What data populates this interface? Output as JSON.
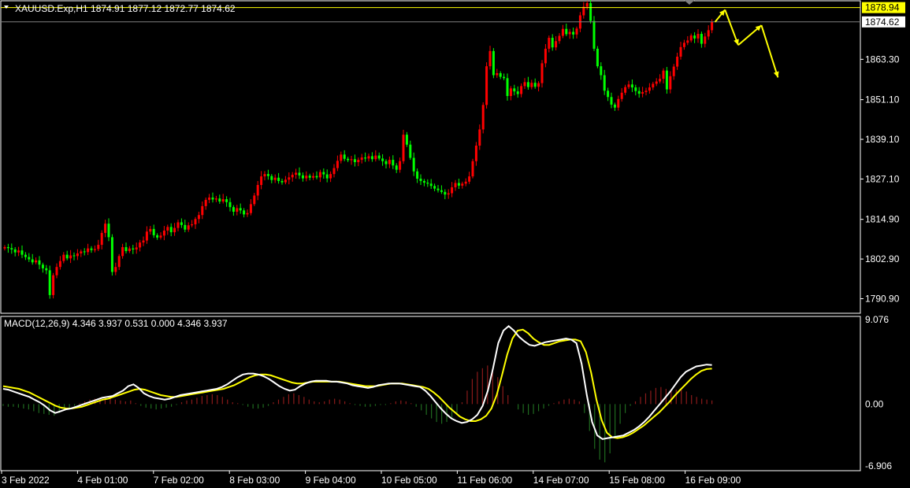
{
  "window": {
    "symbol_info": "XAUUSD.Exp,H1  1874.91 1877.12 1872.77 1874.62",
    "macd_info": "MACD(12,26,9) 4.346 3.937 0.531 0.000 4.346 3.937"
  },
  "colors": {
    "background": "#000000",
    "frame": "#ffffff",
    "bull": "#ff0000",
    "bear": "#00ff00",
    "hist_pos": "#8b1a1a",
    "hist_neg": "#1f6b1f",
    "macd_line": "#ffffff",
    "signal_line": "#ffff00",
    "forecast_arrow": "#ffff00",
    "level_line": "#ffff00",
    "bid_line": "#808080"
  },
  "price_axis": {
    "ticks": [
      "1863.30",
      "1851.10",
      "1839.10",
      "1827.10",
      "1814.90",
      "1802.90",
      "1790.90"
    ],
    "level_high": "1878.94",
    "level_current": "1874.62"
  },
  "macd_axis": {
    "ticks": [
      "9.076",
      "0.00",
      "-6.906"
    ]
  },
  "time_axis": {
    "labels": [
      "3 Feb 2022",
      "4 Feb 01:00",
      "7 Feb 02:00",
      "8 Feb 03:00",
      "9 Feb 04:00",
      "10 Feb 05:00",
      "11 Feb 06:00",
      "14 Feb 07:00",
      "15 Feb 08:00",
      "16 Feb 09:00"
    ]
  },
  "chart_data": {
    "type": "line",
    "title": "XAUUSD.Exp,H1",
    "price_range": [
      1786.5,
      1881.0
    ],
    "macd_range": [
      -6.906,
      9.076
    ],
    "close_series": [
      1806.5,
      1806.2,
      1805.8,
      1804.9,
      1805.5,
      1804.2,
      1803.5,
      1802.8,
      1801.9,
      1802.5,
      1801.2,
      1800.1,
      1799.5,
      1792.0,
      1798.0,
      1800.5,
      1802.3,
      1804.2,
      1803.1,
      1804.0,
      1803.8,
      1804.6,
      1805.2,
      1805.0,
      1806.1,
      1805.6,
      1805.9,
      1807.2,
      1810.8,
      1813.6,
      1809.5,
      1799.0,
      1800.5,
      1803.8,
      1806.5,
      1805.3,
      1806.1,
      1805.8,
      1806.4,
      1807.9,
      1808.5,
      1811.2,
      1812.0,
      1810.1,
      1809.4,
      1810.0,
      1811.5,
      1812.6,
      1811.0,
      1812.3,
      1814.0,
      1813.2,
      1811.8,
      1813.1,
      1813.4,
      1815.0,
      1816.2,
      1818.9,
      1820.8,
      1821.5,
      1820.9,
      1821.2,
      1820.3,
      1821.0,
      1820.1,
      1818.6,
      1817.2,
      1818.3,
      1817.6,
      1816.4,
      1816.8,
      1819.5,
      1822.1,
      1825.3,
      1827.9,
      1828.6,
      1828.0,
      1826.8,
      1827.5,
      1826.5,
      1826.1,
      1826.9,
      1827.6,
      1828.4,
      1829.0,
      1828.2,
      1827.3,
      1828.1,
      1827.5,
      1828.0,
      1827.6,
      1829.2,
      1828.5,
      1827.3,
      1828.6,
      1830.4,
      1832.6,
      1834.5,
      1833.2,
      1832.8,
      1833.1,
      1832.2,
      1832.9,
      1833.6,
      1833.3,
      1834.0,
      1833.1,
      1834.2,
      1833.3,
      1832.5,
      1831.6,
      1832.9,
      1831.2,
      1829.9,
      1832.5,
      1840.5,
      1837.5,
      1833.5,
      1829.4,
      1827.2,
      1826.5,
      1826.0,
      1825.7,
      1825.0,
      1824.2,
      1823.7,
      1823.2,
      1822.4,
      1822.8,
      1824.6,
      1825.9,
      1825.1,
      1825.7,
      1826.3,
      1827.9,
      1832.5,
      1837.2,
      1842.1,
      1849.5,
      1861.2,
      1865.8,
      1858.5,
      1859.1,
      1858.0,
      1857.6,
      1852.2,
      1854.5,
      1853.6,
      1852.8,
      1855.2,
      1856.4,
      1854.9,
      1856.2,
      1855.0,
      1856.1,
      1862.1,
      1866.5,
      1869.8,
      1866.9,
      1868.8,
      1870.4,
      1872.5,
      1870.9,
      1871.6,
      1870.8,
      1872.6,
      1876.6,
      1879.2,
      1880.3,
      1874.9,
      1866.5,
      1861.2,
      1858.5,
      1853.8,
      1851.9,
      1849.6,
      1848.7,
      1851.3,
      1853.2,
      1854.9,
      1855.7,
      1854.8,
      1853.7,
      1852.9,
      1853.4,
      1853.8,
      1854.8,
      1855.9,
      1856.6,
      1857.4,
      1859.9,
      1854.2,
      1858.2,
      1861.1,
      1864.1,
      1867.0,
      1868.3,
      1869.0,
      1870.5,
      1869.6,
      1871.0,
      1868.0,
      1870.2,
      1872.1,
      1874.6
    ],
    "forecast_path": [
      [
        1874.6,
        0
      ],
      [
        1878.3,
        3
      ],
      [
        1867.6,
        7
      ],
      [
        1873.6,
        14
      ],
      [
        1857.8,
        19
      ]
    ],
    "macd_line": [
      1.7,
      1.6,
      1.4,
      1.2,
      1.0,
      0.8,
      0.5,
      0.2,
      -0.2,
      -0.7,
      -1.0,
      -0.8,
      -0.6,
      -0.5,
      -0.3,
      -0.1,
      0.1,
      0.3,
      0.5,
      0.7,
      0.8,
      0.9,
      1.2,
      1.5,
      2.0,
      2.2,
      1.8,
      1.2,
      0.9,
      0.7,
      0.6,
      0.5,
      0.6,
      0.8,
      1.0,
      1.1,
      1.2,
      1.3,
      1.4,
      1.5,
      1.6,
      1.7,
      1.9,
      2.2,
      2.6,
      3.0,
      3.3,
      3.4,
      3.4,
      3.3,
      3.1,
      2.8,
      2.4,
      2.0,
      1.7,
      1.5,
      1.6,
      2.0,
      2.3,
      2.5,
      2.6,
      2.6,
      2.6,
      2.5,
      2.5,
      2.4,
      2.3,
      2.1,
      2.0,
      1.9,
      1.8,
      1.9,
      2.1,
      2.2,
      2.3,
      2.3,
      2.3,
      2.2,
      2.1,
      2.0,
      1.9,
      1.5,
      0.9,
      0.2,
      -0.5,
      -1.1,
      -1.6,
      -1.9,
      -2.1,
      -2.0,
      -1.7,
      -1.2,
      -0.2,
      1.5,
      4.0,
      6.8,
      8.2,
      8.7,
      8.2,
      7.5,
      7.0,
      6.6,
      6.5,
      6.7,
      6.9,
      7.0,
      7.1,
      7.2,
      7.3,
      7.2,
      6.8,
      4.5,
      1.0,
      -2.0,
      -3.5,
      -3.9,
      -3.8,
      -3.7,
      -3.6,
      -3.5,
      -3.2,
      -2.9,
      -2.5,
      -2.0,
      -1.4,
      -0.7,
      0.0,
      0.7,
      1.4,
      2.2,
      3.0,
      3.6,
      3.9,
      4.2,
      4.3,
      4.4,
      4.35
    ],
    "signal_line": [
      2.0,
      1.9,
      1.8,
      1.7,
      1.5,
      1.3,
      1.0,
      0.7,
      0.4,
      0.1,
      -0.2,
      -0.4,
      -0.5,
      -0.5,
      -0.4,
      -0.3,
      -0.1,
      0.1,
      0.3,
      0.5,
      0.6,
      0.8,
      1.0,
      1.2,
      1.4,
      1.6,
      1.7,
      1.6,
      1.4,
      1.2,
      1.0,
      0.9,
      0.8,
      0.8,
      0.9,
      1.0,
      1.1,
      1.2,
      1.3,
      1.4,
      1.5,
      1.6,
      1.7,
      1.9,
      2.1,
      2.4,
      2.7,
      3.0,
      3.2,
      3.3,
      3.3,
      3.2,
      3.0,
      2.8,
      2.6,
      2.4,
      2.3,
      2.3,
      2.4,
      2.5,
      2.5,
      2.5,
      2.5,
      2.5,
      2.5,
      2.4,
      2.3,
      2.2,
      2.1,
      2.0,
      2.0,
      2.0,
      2.1,
      2.2,
      2.3,
      2.3,
      2.3,
      2.2,
      2.1,
      2.0,
      1.9,
      1.7,
      1.3,
      0.8,
      0.2,
      -0.4,
      -0.9,
      -1.4,
      -1.7,
      -1.9,
      -1.9,
      -1.7,
      -1.3,
      -0.5,
      1.0,
      3.2,
      5.5,
      7.3,
      8.2,
      8.3,
      7.9,
      7.3,
      6.9,
      6.6,
      6.6,
      6.8,
      7.0,
      7.1,
      7.2,
      7.2,
      7.0,
      5.8,
      3.5,
      0.5,
      -1.8,
      -3.2,
      -3.7,
      -3.8,
      -3.7,
      -3.5,
      -3.2,
      -2.8,
      -2.4,
      -1.9,
      -1.4,
      -0.9,
      -0.3,
      0.3,
      1.0,
      1.6,
      2.2,
      2.8,
      3.3,
      3.7,
      3.9,
      3.95
    ],
    "histogram": [
      -0.2,
      -0.3,
      -0.3,
      -0.4,
      -0.5,
      -0.6,
      -0.8,
      -1.0,
      -1.1,
      -1.2,
      -1.3,
      -1.0,
      -0.7,
      -0.4,
      -0.2,
      0.1,
      0.3,
      0.5,
      0.6,
      0.7,
      0.7,
      0.6,
      0.5,
      0.4,
      0.3,
      0.4,
      0.1,
      -0.2,
      -0.4,
      -0.5,
      -0.6,
      -0.5,
      -0.4,
      -0.3,
      -0.1,
      0.2,
      0.4,
      0.5,
      0.7,
      0.9,
      1.0,
      1.1,
      1.0,
      0.8,
      0.5,
      0.2,
      0.1,
      -0.1,
      -0.3,
      -0.5,
      -0.5,
      -0.4,
      -0.2,
      0.2,
      0.5,
      0.8,
      1.1,
      1.2,
      1.0,
      0.8,
      0.5,
      0.3,
      0.2,
      0.3,
      0.5,
      0.6,
      0.5,
      0.3,
      0.1,
      -0.1,
      -0.2,
      -0.3,
      -0.3,
      -0.2,
      -0.1,
      -0.1,
      0.1,
      0.3,
      0.4,
      0.3,
      0.1,
      -0.3,
      -0.7,
      -1.2,
      -1.6,
      -2.0,
      -2.2,
      -2.0,
      -1.6,
      -1.0,
      0.2,
      1.5,
      2.8,
      3.6,
      4.0,
      4.3,
      3.8,
      3.0,
      2.0,
      1.0,
      0.0,
      -0.6,
      -1.0,
      -1.2,
      -1.1,
      -0.8,
      -0.5,
      -0.2,
      0.1,
      0.3,
      0.5,
      0.6,
      0.5,
      0.3,
      -1.0,
      -3.0,
      -5.0,
      -6.2,
      -6.5,
      -5.5,
      -3.8,
      -2.2,
      -1.0,
      -0.2,
      0.3,
      0.8,
      1.2,
      1.5,
      1.8,
      1.9,
      1.7,
      1.5,
      1.6,
      1.7,
      1.4,
      1.0,
      0.8,
      0.6,
      0.5,
      0.4
    ]
  }
}
